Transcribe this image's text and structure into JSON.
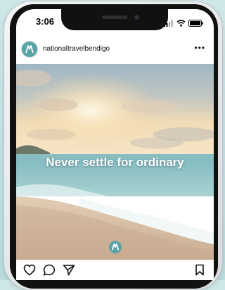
{
  "status_bar": {
    "time": "3:06",
    "icons": [
      "signal-icon",
      "wifi-icon",
      "battery-icon"
    ]
  },
  "post": {
    "username": "nationaltravelbendigo",
    "more_label": "•••",
    "headline": "Never settle for ordinary",
    "avatar_icon": "brand-logo-icon"
  },
  "actions": [
    "heart-icon",
    "comment-icon",
    "share-icon",
    "bookmark-icon"
  ],
  "colors": {
    "brand": "#5aa3a6",
    "background": "#c7e3e5"
  }
}
